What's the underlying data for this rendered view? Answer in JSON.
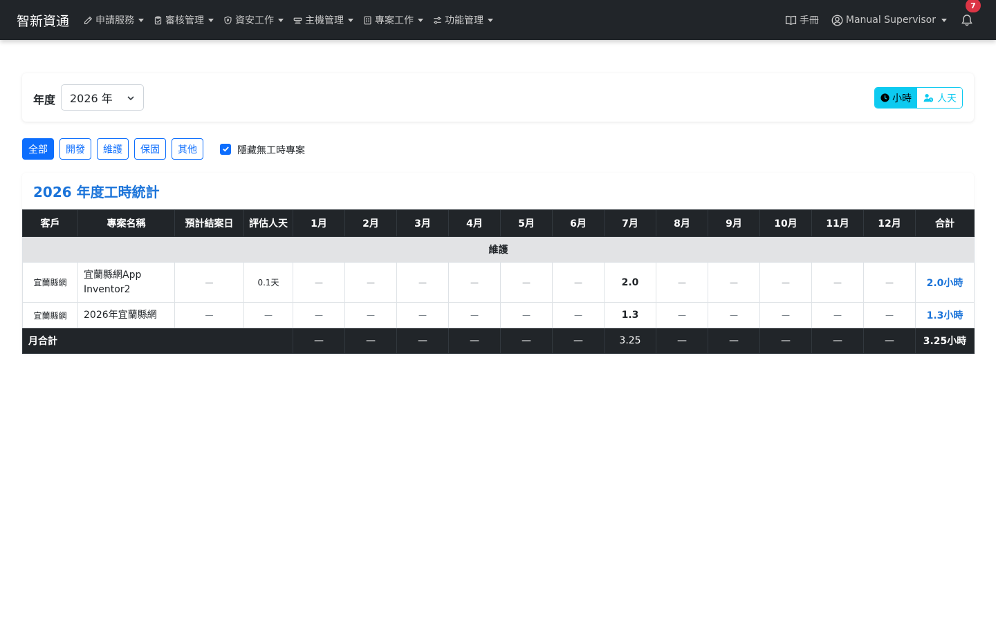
{
  "navbar": {
    "brand": "智新資通",
    "menus": [
      {
        "label": "申請服務",
        "icon": "edit-icon"
      },
      {
        "label": "審核管理",
        "icon": "clipboard-check-icon"
      },
      {
        "label": "資安工作",
        "icon": "shield-icon"
      },
      {
        "label": "主機管理",
        "icon": "router-icon"
      },
      {
        "label": "專案工作",
        "icon": "building-icon"
      },
      {
        "label": "功能管理",
        "icon": "sliders-icon"
      }
    ],
    "manual_label": "手冊",
    "user_name": "Manual Supervisor",
    "notification_count": "7"
  },
  "filters": {
    "year_label": "年度",
    "year_value": "2026 年",
    "unit_hours": "小時",
    "unit_days": "人天",
    "categories": [
      "全部",
      "開發",
      "維護",
      "保固",
      "其他"
    ],
    "active_category": "全部",
    "hide_empty_label": "隱藏無工時專案",
    "hide_empty_checked": true
  },
  "stats": {
    "title": "2026 年度工時統計",
    "columns": [
      "客戶",
      "專案名稱",
      "預計結案日",
      "評估人天",
      "1月",
      "2月",
      "3月",
      "4月",
      "5月",
      "6月",
      "7月",
      "8月",
      "9月",
      "10月",
      "11月",
      "12月",
      "合計"
    ],
    "group_label": "維護",
    "rows": [
      {
        "client": "宜蘭縣網",
        "project_line1": "宜蘭縣網App",
        "project_line2": "Inventor2",
        "due": "—",
        "estimate": "0.1天",
        "months": [
          "—",
          "—",
          "—",
          "—",
          "—",
          "—",
          "2.0",
          "—",
          "—",
          "—",
          "—",
          "—"
        ],
        "total": "2.0小時"
      },
      {
        "client": "宜蘭縣網",
        "project_line1": "2026年宜蘭縣網",
        "project_line2": "",
        "due": "—",
        "estimate": "—",
        "months": [
          "—",
          "—",
          "—",
          "—",
          "—",
          "—",
          "1.3",
          "—",
          "—",
          "—",
          "—",
          "—"
        ],
        "total": "1.3小時"
      }
    ],
    "footer_label": "月合計",
    "footer_months": [
      "—",
      "—",
      "—",
      "—",
      "—",
      "—",
      "3.25",
      "—",
      "—",
      "—",
      "—",
      "—"
    ],
    "footer_total": "3.25小時"
  }
}
